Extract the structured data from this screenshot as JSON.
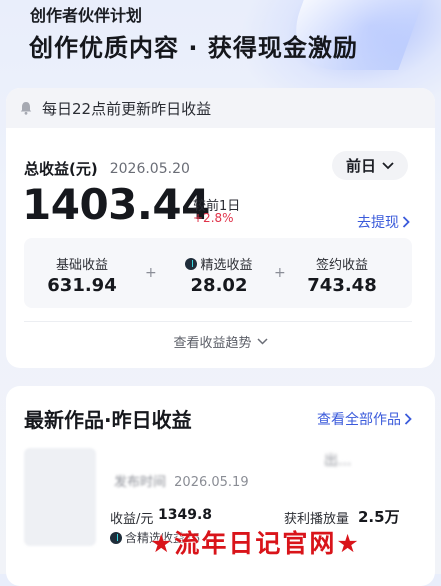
{
  "hero": {
    "subtitle": "创作者伙伴计划",
    "headline": "创作优质内容 · 获得现金激励"
  },
  "notice": {
    "text": "每日22点前更新昨日收益",
    "icon": "bell-icon"
  },
  "earnings": {
    "total_label": "总收益(元)",
    "date": "2026.05.20",
    "period_selector": "前日",
    "amount": "1403.44",
    "compare_label": "较前1日",
    "compare_value": "+2.8%",
    "withdraw_label": "去提现",
    "breakdown": [
      {
        "label": "基础收益",
        "value": "631.94"
      },
      {
        "label": "精选收益",
        "value": "28.02"
      },
      {
        "label": "签约收益",
        "value": "743.48"
      }
    ],
    "plus_sign": "+",
    "trend_label": "查看收益趋势"
  },
  "works": {
    "title": "最新作品·昨日收益",
    "view_all": "查看全部作品",
    "item": {
      "title_partial": "出...",
      "publish_label": "发布时间",
      "publish_date": "2026.05.19",
      "income_label": "收益/元",
      "income_value": "1349.8",
      "play_label": "获利播放量",
      "play_value": "2.5万",
      "sub_income": "含精选收益75"
    }
  },
  "watermark": "★流年日记官网★",
  "colors": {
    "accent_blue": "#3b5bdb",
    "increase_red": "#e0334a",
    "watermark_red": "#d9141a"
  }
}
